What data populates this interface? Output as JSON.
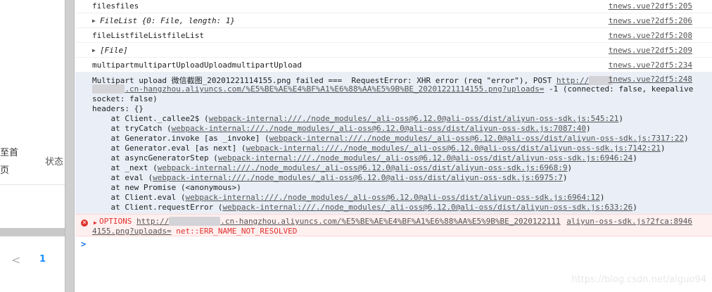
{
  "left_panel": {
    "header_line1": "至首",
    "header_line2": "页",
    "header_status": "状态",
    "prev_arrow": "<",
    "page_number": "1"
  },
  "console": {
    "rows": [
      {
        "text": "filesfiles",
        "source": "tnews.vue?2df5:205"
      },
      {
        "text": "FileList {0: File, length: 1}",
        "source": "tnews.vue?2df5:206"
      },
      {
        "text": "fileListfileListfileList",
        "source": "tnews.vue?2df5:208"
      },
      {
        "text": "[File]",
        "source": "tnews.vue?2df5:209"
      },
      {
        "text": "multipartmultipartUploadUploadmultipartUpload",
        "source": "tnews.vue?2df5:234"
      }
    ],
    "error_block": {
      "line1_text": "Multipart upload 微信截图_20201221114155.png failed ===  RequestError: XHR error (req \"error\"), POST ",
      "line1_link": "http://",
      "line1_source": "tnews.vue?2df5:248",
      "line2_link": ".cn-hangzhou.aliyuncs.com/%E5%BE%AE%E4%BF%A1%E6%88%AA%E5%9B%BE_20201221114155.png?uploads=",
      "line2_tail": " -1 (connected: false, keepalive",
      "line3": "socket: false)",
      "line4": "headers: {}",
      "stack": [
        {
          "pre": "    at Client._callee2$ (",
          "link": "webpack-internal:///./node_modules/_ali-oss@6.12.0@ali-oss/dist/aliyun-oss-sdk.js:545:21",
          "post": ")"
        },
        {
          "pre": "    at tryCatch (",
          "link": "webpack-internal:///./node_modules/_ali-oss@6.12.0@ali-oss/dist/aliyun-oss-sdk.js:7087:40",
          "post": ")"
        },
        {
          "pre": "    at Generator.invoke [as _invoke] (",
          "link": "webpack-internal:///./node_modules/_ali-oss@6.12.0@ali-oss/dist/aliyun-oss-sdk.js:7317:22",
          "post": ")"
        },
        {
          "pre": "    at Generator.eval [as next] (",
          "link": "webpack-internal:///./node_modules/_ali-oss@6.12.0@ali-oss/dist/aliyun-oss-sdk.js:7142:21",
          "post": ")"
        },
        {
          "pre": "    at asyncGeneratorStep (",
          "link": "webpack-internal:///./node_modules/_ali-oss@6.12.0@ali-oss/dist/aliyun-oss-sdk.js:6946:24",
          "post": ")"
        },
        {
          "pre": "    at _next (",
          "link": "webpack-internal:///./node_modules/_ali-oss@6.12.0@ali-oss/dist/aliyun-oss-sdk.js:6968:9",
          "post": ")"
        },
        {
          "pre": "    at eval (",
          "link": "webpack-internal:///./node_modules/_ali-oss@6.12.0@ali-oss/dist/aliyun-oss-sdk.js:6975:7",
          "post": ")"
        },
        {
          "pre": "    at new Promise (<anonymous>)",
          "link": "",
          "post": ""
        },
        {
          "pre": "    at Client.eval (",
          "link": "webpack-internal:///./node_modules/_ali-oss@6.12.0@ali-oss/dist/aliyun-oss-sdk.js:6964:12",
          "post": ")"
        },
        {
          "pre": "    at Client.requestError (",
          "link": "webpack-internal:///./node_modules/_ali-oss@6.12.0@ali-oss/dist/aliyun-oss-sdk.js:633:26",
          "post": ")"
        }
      ]
    },
    "options_error": {
      "method": "OPTIONS",
      "link1": "http://",
      "link1_rest": ".cn-hangzhou.aliyuncs.com/%E5%BE%AE%E4%BF%A1%E6%88%AA%E5%9B%BE_20201221114155.png?uploads=",
      "link1_rest_a": ".cn-hangzhou.aliyuncs.com/%E5%BE%AE%E4%BF%A1%E6%88%AA%E5%9B%BE_2020122111",
      "link1_rest_b": "4155.png?uploads=",
      "message": "net::ERR_NAME_NOT_RESOLVED",
      "source": "aliyun-oss-sdk.js?2fca:8946"
    },
    "prompt": ">",
    "watermark": "https://blog.csdn.net/aiguo94"
  },
  "colors": {
    "error_red": "#e0322e",
    "link_blue": "#1a73e8",
    "error_bg": "#e9eef7"
  }
}
